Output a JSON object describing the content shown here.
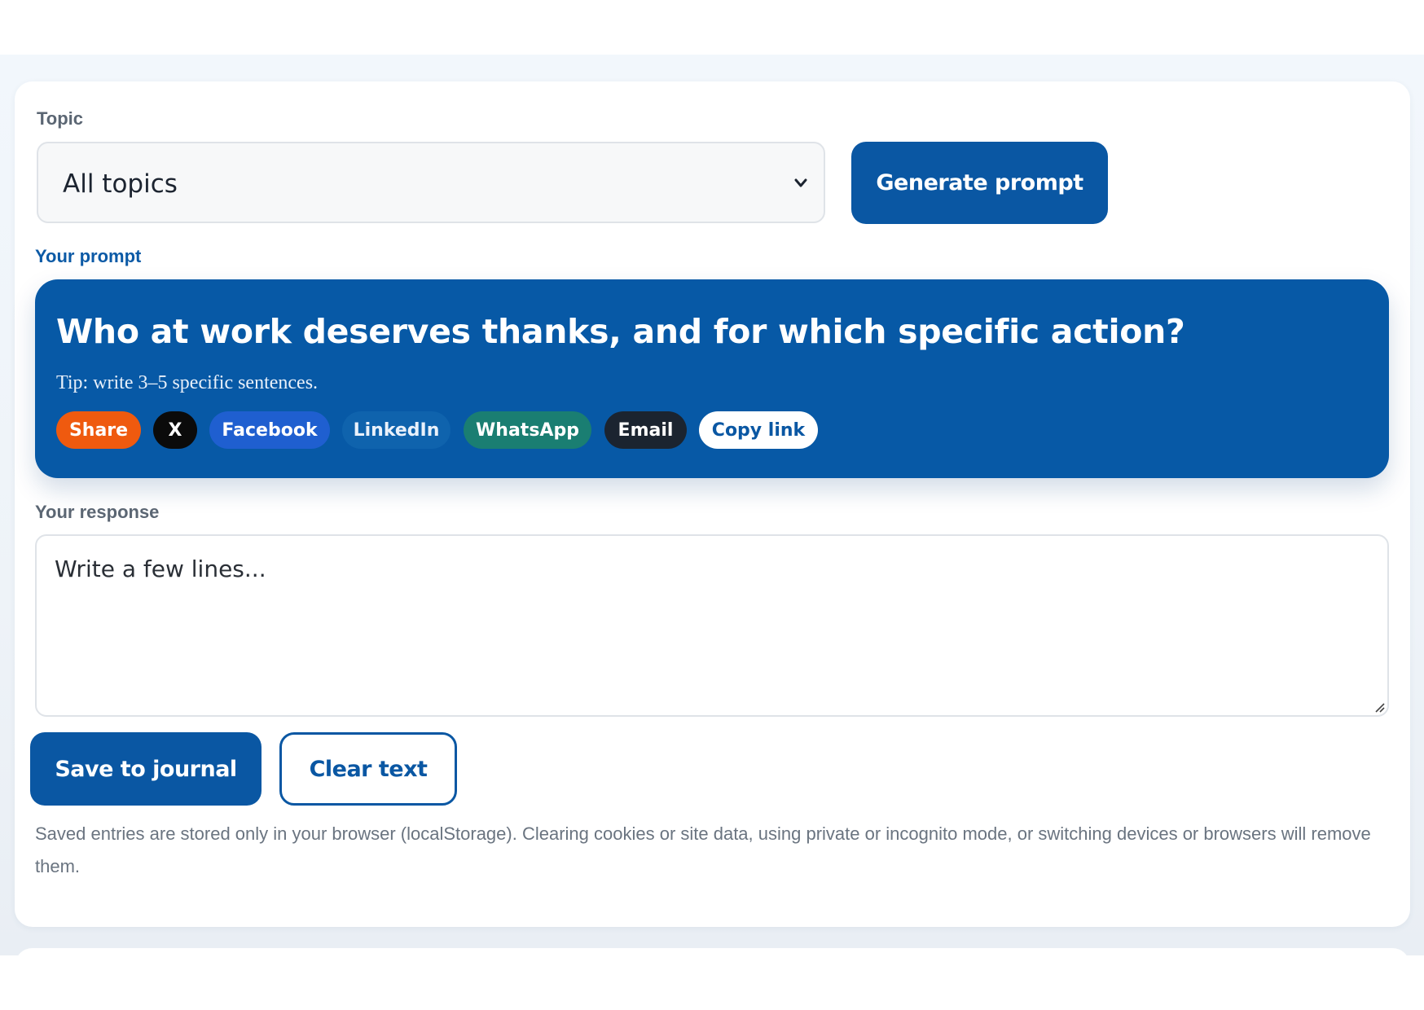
{
  "topic": {
    "label": "Topic",
    "selected": "All topics"
  },
  "generate_button": "Generate prompt",
  "prompt": {
    "label": "Your prompt",
    "question": "Who at work deserves thanks, and for which specific action?",
    "tip": "Tip: write 3–5 specific sentences.",
    "share_chips": {
      "share": "Share",
      "x": "X",
      "facebook": "Facebook",
      "linkedin": "LinkedIn",
      "whatsapp": "WhatsApp",
      "email": "Email",
      "copy_link": "Copy link"
    }
  },
  "response": {
    "label": "Your response",
    "placeholder": "Write a few lines..."
  },
  "actions": {
    "save": "Save to journal",
    "clear": "Clear text"
  },
  "storage_note": "Saved entries are stored only in your browser (localStorage). Clearing cookies or site data, using private or incognito mode, or switching devices or browsers will remove them.",
  "colors": {
    "primary": "#0a57a3",
    "prompt_bg": "#0759a6",
    "share": "#ef5a0f",
    "x": "#0b0b0b",
    "facebook": "#1f5fd0",
    "whatsapp": "#1a7e72",
    "email": "#1b2430"
  }
}
